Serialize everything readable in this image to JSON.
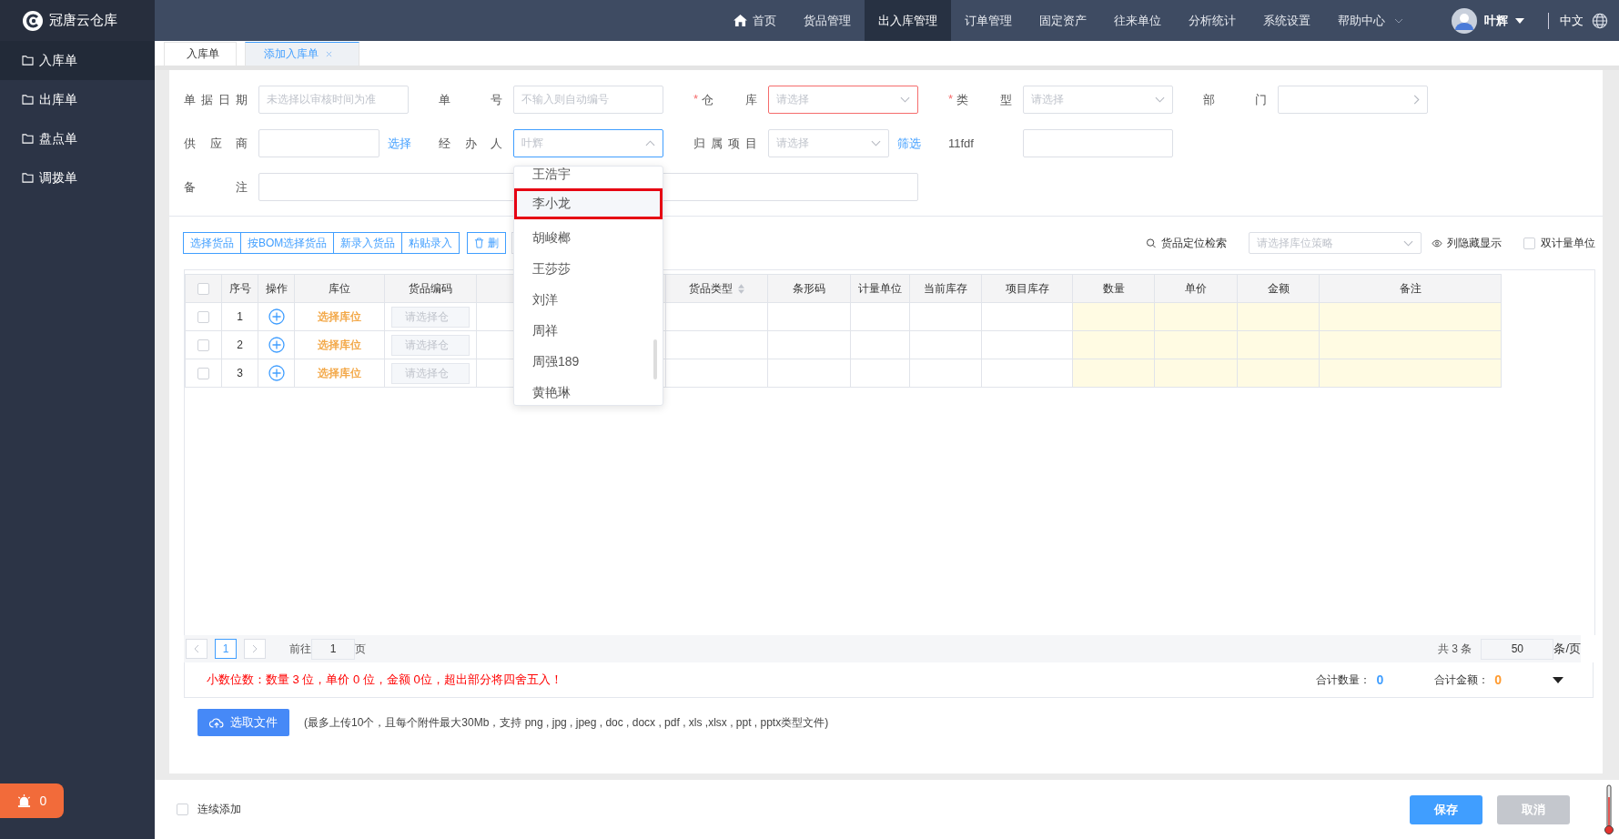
{
  "brand": {
    "name": "冠唐云仓库"
  },
  "nav": [
    {
      "label": "首页",
      "kind": "home",
      "selected": false
    },
    {
      "label": "货品管理",
      "kind": "link",
      "selected": false
    },
    {
      "label": "出入库管理",
      "kind": "link",
      "selected": true
    },
    {
      "label": "订单管理",
      "kind": "link",
      "selected": false
    },
    {
      "label": "固定资产",
      "kind": "link",
      "selected": false
    },
    {
      "label": "往来单位",
      "kind": "link",
      "selected": false
    },
    {
      "label": "分析统计",
      "kind": "link",
      "selected": false
    },
    {
      "label": "系统设置",
      "kind": "link",
      "selected": false
    },
    {
      "label": "帮助中心",
      "kind": "menu",
      "selected": false
    }
  ],
  "user": {
    "name": "叶辉"
  },
  "language": "中文",
  "sidebar": [
    {
      "label": "入库单",
      "selected": true
    },
    {
      "label": "出库单",
      "selected": false
    },
    {
      "label": "盘点单",
      "selected": false
    },
    {
      "label": "调拨单",
      "selected": false
    }
  ],
  "alarm": {
    "count": "0"
  },
  "tabs": [
    {
      "label": "入库单",
      "selected": false,
      "closable": false
    },
    {
      "label": "添加入库单",
      "selected": true,
      "closable": true
    }
  ],
  "form": [
    [
      {
        "label": "单据日期",
        "kind": "input",
        "placeholder": "未选择以审核时间为准",
        "invalid": false,
        "open": false
      },
      {
        "label": "单号",
        "kind": "input",
        "placeholder": "不输入则自动编号",
        "invalid": false,
        "open": false
      },
      {
        "required_mark": "*",
        "label": "仓库",
        "kind": "select",
        "placeholder": "请选择",
        "invalid": true,
        "open": false
      },
      {
        "required_mark": "*",
        "label": "类型",
        "kind": "select",
        "placeholder": "请选择",
        "invalid": false,
        "open": false
      },
      {
        "label": "部门",
        "kind": "cascader",
        "invalid": false,
        "open": false
      }
    ],
    [
      {
        "label": "供应商",
        "kind": "input",
        "link": "选择",
        "invalid": false,
        "open": false
      },
      {
        "label": "经办人",
        "kind": "select",
        "placeholder": "叶辉",
        "invalid": false,
        "open": true
      },
      {
        "label": "归属项目",
        "kind": "select",
        "placeholder": "请选择",
        "link": "筛选",
        "invalid": false,
        "open": false
      },
      {
        "label": "11fdf",
        "kind": "input",
        "invalid": false,
        "open": false
      }
    ],
    [
      {
        "label": "备注",
        "kind": "long-input",
        "invalid": false,
        "open": false
      }
    ]
  ],
  "dropdown": {
    "options": [
      {
        "label": "王浩宇",
        "selected": false
      },
      {
        "label": "李小龙",
        "selected": true
      },
      {
        "label": "胡峻榔",
        "selected": false
      },
      {
        "label": "王莎莎",
        "selected": false
      },
      {
        "label": "刘洋",
        "selected": false
      },
      {
        "label": "周祥",
        "selected": false
      },
      {
        "label": "周强189",
        "selected": false
      },
      {
        "label": "黄艳琳",
        "selected": false
      }
    ]
  },
  "toolbar": {
    "buttons": [
      "选择货品",
      "按BOM选择货品",
      "新录入货品",
      "粘贴录入"
    ],
    "delete": "删",
    "locate": "货品定位检索",
    "strategy_placeholder": "请选择库位策略",
    "columns_toggle": "列隐藏显示",
    "dual_unit": {
      "label": "双计量单位",
      "checked": false
    }
  },
  "table": {
    "all_checked": false,
    "columns": [
      {
        "kind": "check"
      },
      {
        "label": "序号",
        "kind": "index"
      },
      {
        "label": "操作",
        "kind": "action"
      },
      {
        "label": "库位",
        "kind": "location"
      },
      {
        "label": "货品编码",
        "kind": "code"
      },
      {
        "kind": "text"
      },
      {
        "label": "货品类型",
        "kind": "text",
        "sortable": true
      },
      {
        "label": "条形码",
        "kind": "text"
      },
      {
        "label": "计量单位",
        "kind": "text"
      },
      {
        "label": "当前库存",
        "kind": "text"
      },
      {
        "label": "项目库存",
        "kind": "text"
      },
      {
        "label": "数量",
        "kind": "entry"
      },
      {
        "label": "单价",
        "kind": "entry"
      },
      {
        "label": "金额",
        "kind": "entry"
      },
      {
        "label": "备注",
        "kind": "entry"
      }
    ],
    "rows": [
      {
        "checked": false,
        "index": "1",
        "location": "选择库位",
        "code_placeholder": "请选择仓"
      },
      {
        "checked": false,
        "index": "2",
        "location": "选择库位",
        "code_placeholder": "请选择仓"
      },
      {
        "checked": false,
        "index": "3",
        "location": "选择库位",
        "code_placeholder": "请选择仓"
      }
    ]
  },
  "pagination": {
    "pages": [
      {
        "label": "1",
        "selected": true
      }
    ],
    "goto_label": "前往",
    "goto_value": "1",
    "goto_suffix": "页",
    "total": "共 3 条",
    "page_size": "50",
    "size_suffix": "条/页"
  },
  "notice": "小数位数：数量 3 位，单价 0 位，金额 0位，超出部分将四舍五入！",
  "totals": [
    {
      "label": "合计数量：",
      "value": "0",
      "color": "#409eff"
    },
    {
      "label": "合计金额：",
      "value": "0",
      "color": "#ff9a2e"
    }
  ],
  "upload": {
    "button": "选取文件",
    "hint": "(最多上传10个，且每个附件最大30Mb，支持 png , jpg , jpeg , doc , docx , pdf , xls ,xlsx , ppt , pptx类型文件)"
  },
  "footer": {
    "continuous": {
      "label": "连续添加",
      "checked": false
    },
    "buttons": [
      {
        "label": "保存",
        "kind": "primary"
      },
      {
        "label": "取消",
        "kind": "muted"
      }
    ]
  }
}
